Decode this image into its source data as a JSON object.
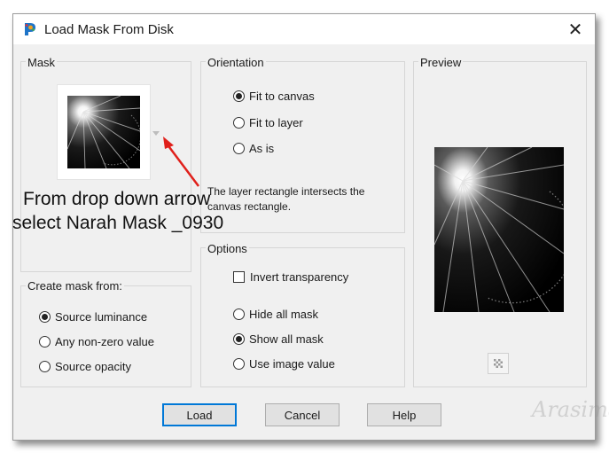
{
  "dialog": {
    "title": "Load Mask From Disk",
    "close_glyph": "✕"
  },
  "mask_group": {
    "label": "Mask"
  },
  "create_group": {
    "label": "Create mask from:",
    "options": [
      {
        "label": "Source luminance",
        "selected": true
      },
      {
        "label": "Any non-zero value",
        "selected": false
      },
      {
        "label": "Source opacity",
        "selected": false
      }
    ]
  },
  "orientation_group": {
    "label": "Orientation",
    "options": [
      {
        "label": "Fit to canvas",
        "selected": true
      },
      {
        "label": "Fit to layer",
        "selected": false
      },
      {
        "label": "As is",
        "selected": false
      }
    ],
    "description": "The layer rectangle intersects the canvas rectangle."
  },
  "options_group": {
    "label": "Options",
    "invert_label": "Invert transparency",
    "invert_checked": false,
    "mask_options": [
      {
        "label": "Hide all mask",
        "selected": false
      },
      {
        "label": "Show all mask",
        "selected": true
      },
      {
        "label": "Use image value",
        "selected": false
      }
    ]
  },
  "preview_group": {
    "label": "Preview"
  },
  "buttons": {
    "load": "Load",
    "cancel": "Cancel",
    "help": "Help"
  },
  "annotation": {
    "line1": "From drop down arrow",
    "line2": "select Narah Mask _0930",
    "arrow_color": "#e0201b"
  },
  "watermark": "Arasimages",
  "colors": {
    "accent": "#0078d7",
    "dialog_bg": "#f0f0f0"
  }
}
